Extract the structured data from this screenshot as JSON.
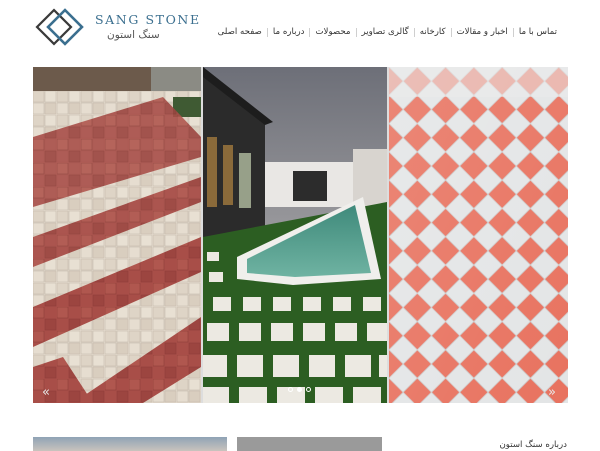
{
  "brand": {
    "name_en": "SANG STONE",
    "name_fa": "سنگ استون"
  },
  "nav": {
    "items": [
      {
        "label": "صفحه اصلی"
      },
      {
        "label": "درباره ما"
      },
      {
        "label": "محصولات"
      },
      {
        "label": "گالری تصاویر"
      },
      {
        "label": "کارخانه"
      },
      {
        "label": "اخبار و مقالات"
      },
      {
        "label": "تماس با ما"
      }
    ]
  },
  "slider": {
    "dots_total": 3,
    "active_dot": 1,
    "prev_glyph": "«",
    "next_glyph": "»"
  },
  "about": {
    "heading": "درباره سنگ استون"
  },
  "colors": {
    "brand_blue": "#3b6f8f",
    "paver_red": "#a84e48",
    "paver_cream": "#e4dcd0",
    "grass_green": "#2c5e22",
    "pool_teal": "#4f9a88",
    "tile_orange": "#e56f5c"
  }
}
